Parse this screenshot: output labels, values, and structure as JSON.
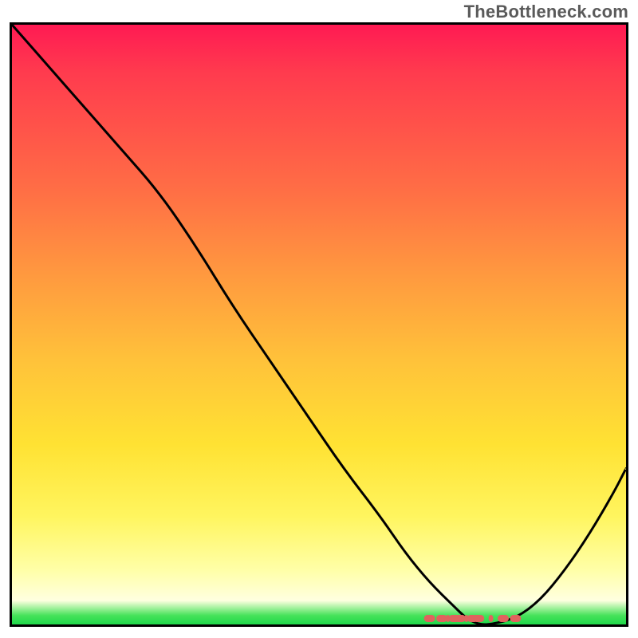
{
  "watermark": "TheBottleneck.com",
  "chart_data": {
    "type": "line",
    "title": "",
    "xlabel": "",
    "ylabel": "",
    "xlim": [
      0,
      100
    ],
    "ylim": [
      0,
      100
    ],
    "grid": false,
    "series": [
      {
        "name": "curve",
        "x": [
          0,
          6,
          12,
          18,
          24,
          30,
          36,
          42,
          48,
          54,
          60,
          64,
          68,
          72,
          74,
          76,
          78,
          82,
          86,
          90,
          94,
          98,
          100
        ],
        "values": [
          100,
          93,
          86,
          79,
          72,
          63,
          53,
          44,
          35,
          26,
          18,
          12,
          7,
          3,
          1,
          0,
          0,
          1,
          4,
          9,
          15,
          22,
          26
        ]
      }
    ],
    "annotations": {
      "valley_markers_x": [
        68,
        70,
        71,
        72,
        73,
        74,
        75,
        76,
        78,
        80,
        82
      ],
      "valley_markers_color": "#e0635e"
    },
    "gradient": {
      "top": "#ff1a53",
      "mid_upper": "#ff9a3f",
      "mid_lower": "#ffe233",
      "near_bottom": "#ffffe0",
      "bottom": "#1fd84a"
    }
  }
}
